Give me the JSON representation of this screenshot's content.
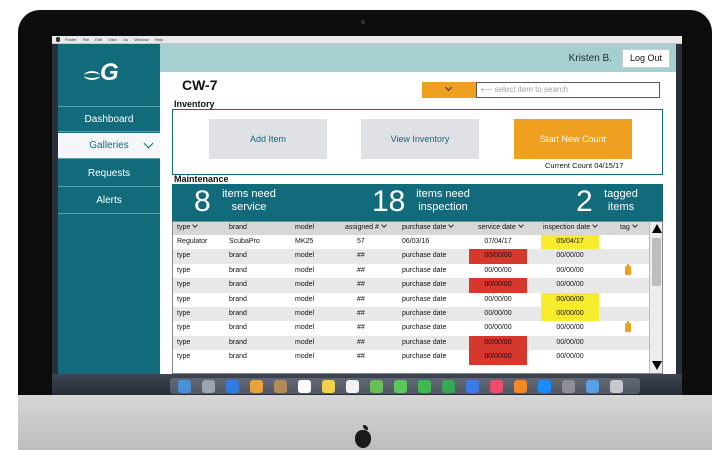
{
  "colors": {
    "brand": "#116b7a",
    "accent": "#f0a020",
    "header_band": "#a6cfd0",
    "alert_red": "#d7382d",
    "alert_yellow": "#f7ec2c"
  },
  "mac_menubar": [
    "Finder",
    "File",
    "Edit",
    "View",
    "Go",
    "Window",
    "Help"
  ],
  "sidebar": {
    "logo_icon": "fish-g-logo",
    "items": [
      {
        "label": "Dashboard"
      },
      {
        "label": "Galleries"
      },
      {
        "label": "Requests"
      },
      {
        "label": "Alerts"
      }
    ]
  },
  "header": {
    "user": "Kristen B.",
    "logout_label": "Log Out"
  },
  "page": {
    "title": "CW-7",
    "inventory_label": "Inventory",
    "maintenance_label": "Maintenance"
  },
  "search": {
    "arrow": "⟵",
    "placeholder": "select item to search"
  },
  "inventory": {
    "add_item": "Add Item",
    "view_inventory": "View Inventory",
    "start_new_count": "Start New Count",
    "current_count": "Current Count 04/15/17"
  },
  "stats": [
    {
      "num": "8",
      "line1": "items need",
      "line2": "service"
    },
    {
      "num": "18",
      "line1": "items need",
      "line2": "inspection"
    },
    {
      "num": "2",
      "line1": "tagged",
      "line2": "items"
    }
  ],
  "table": {
    "headers": [
      "type",
      "brand",
      "model",
      "assigned #",
      "purchase date",
      "service date",
      "inspection date",
      "tag"
    ],
    "rows": [
      {
        "type": "Regulator",
        "brand": "ScubaPro",
        "model": "MK25",
        "assigned": "57",
        "purchase": "06/03/16",
        "service": "07/04/17",
        "inspection": "05/04/17",
        "service_flag": "",
        "inspection_flag": "yellow",
        "tag": false
      },
      {
        "type": "type",
        "brand": "brand",
        "model": "model",
        "assigned": "##",
        "purchase": "purchase date",
        "service": "00/00/00",
        "inspection": "00/00/00",
        "service_flag": "red",
        "inspection_flag": "",
        "tag": false
      },
      {
        "type": "type",
        "brand": "brand",
        "model": "model",
        "assigned": "##",
        "purchase": "purchase date",
        "service": "00/00/00",
        "inspection": "00/00/00",
        "service_flag": "",
        "inspection_flag": "",
        "tag": true
      },
      {
        "type": "type",
        "brand": "brand",
        "model": "model",
        "assigned": "##",
        "purchase": "purchase date",
        "service": "00/00/00",
        "inspection": "00/00/00",
        "service_flag": "red",
        "inspection_flag": "",
        "tag": false
      },
      {
        "type": "type",
        "brand": "brand",
        "model": "model",
        "assigned": "##",
        "purchase": "purchase date",
        "service": "00/00/00",
        "inspection": "00/00/00",
        "service_flag": "",
        "inspection_flag": "yellow",
        "tag": false
      },
      {
        "type": "type",
        "brand": "brand",
        "model": "model",
        "assigned": "##",
        "purchase": "purchase date",
        "service": "00/00/00",
        "inspection": "00/00/00",
        "service_flag": "",
        "inspection_flag": "yellow",
        "tag": false
      },
      {
        "type": "type",
        "brand": "brand",
        "model": "model",
        "assigned": "##",
        "purchase": "purchase date",
        "service": "00/00/00",
        "inspection": "00/00/00",
        "service_flag": "",
        "inspection_flag": "",
        "tag": true
      },
      {
        "type": "type",
        "brand": "brand",
        "model": "model",
        "assigned": "##",
        "purchase": "purchase date",
        "service": "00/00/00",
        "inspection": "00/00/00",
        "service_flag": "red",
        "inspection_flag": "",
        "tag": false
      },
      {
        "type": "type",
        "brand": "brand",
        "model": "model",
        "assigned": "##",
        "purchase": "purchase date",
        "service": "00/00/00",
        "inspection": "00/00/00",
        "service_flag": "red",
        "inspection_flag": "",
        "tag": false
      }
    ]
  },
  "dock_icons": [
    "finder-icon",
    "launchpad-icon",
    "safari-icon",
    "photos-icon",
    "contacts-icon",
    "calendar-icon",
    "notes-icon",
    "reminders-icon",
    "maps-icon",
    "messages-icon",
    "facetime-icon",
    "numbers-icon",
    "keynote-icon",
    "music-icon",
    "books-icon",
    "appstore-icon",
    "settings-icon",
    "folder-icon",
    "trash-icon"
  ]
}
